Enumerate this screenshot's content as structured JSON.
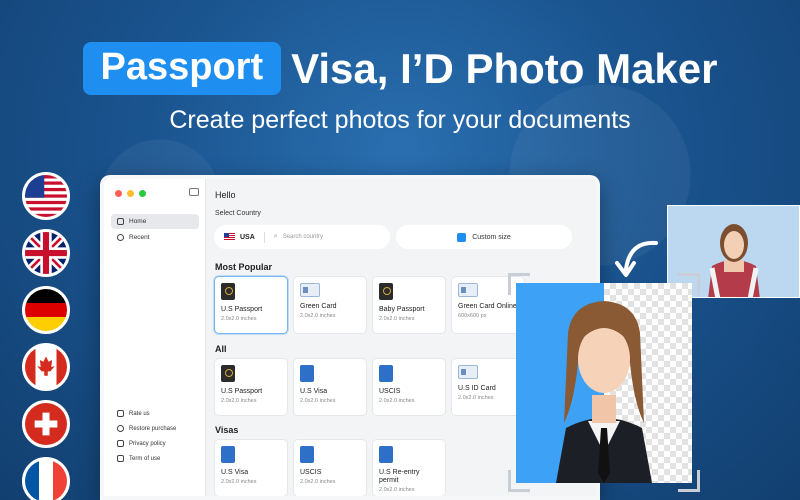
{
  "header": {
    "highlight": "Passport",
    "title_rest": "Visa, I’D Photo Maker",
    "subtitle": "Create perfect photos for your documents"
  },
  "flags": [
    "us-flag-icon",
    "uk-flag-icon",
    "germany-flag-icon",
    "canada-flag-icon",
    "switzerland-flag-icon",
    "france-flag-icon"
  ],
  "colors": {
    "accent": "#1e8ff0",
    "background": "#1a548f"
  },
  "sidebar": {
    "items": [
      {
        "label": "Home",
        "icon": "home-icon",
        "active": true
      },
      {
        "label": "Recent",
        "icon": "clock-icon",
        "active": false
      }
    ],
    "bottom_items": [
      {
        "label": "Rate us",
        "icon": "thumbs-up-icon"
      },
      {
        "label": "Restore purchase",
        "icon": "restore-icon"
      },
      {
        "label": "Privacy policy",
        "icon": "shield-icon"
      },
      {
        "label": "Term of use",
        "icon": "document-icon"
      }
    ]
  },
  "main": {
    "greeting": "Hello",
    "select_country_label": "Select Country",
    "country_code": "USA",
    "search_placeholder": "Search country",
    "custom_size_label": "Custom size",
    "most_popular_title": "Most Popular",
    "most_popular": [
      {
        "name": "U.S Passport",
        "size": "2.0x2.0 inches",
        "selected": true
      },
      {
        "name": "Green Card",
        "size": "2.0x2.0 inches"
      },
      {
        "name": "Baby Passport",
        "size": "2.0x2.0 inches"
      },
      {
        "name": "Green Card Online",
        "size": "600x600 px"
      }
    ],
    "all_title": "All",
    "all": [
      {
        "name": "U.S Passport",
        "size": "2.0x2.0 inches"
      },
      {
        "name": "U.S Visa",
        "size": "2.0x2.0 inches"
      },
      {
        "name": "USCIS",
        "size": "2.0x2.0 inches"
      },
      {
        "name": "U.S ID Card",
        "size": "2.0x2.0 inches"
      }
    ],
    "visas_title": "Visas",
    "visas": [
      {
        "name": "U.S Visa",
        "size": "2.0x2.0 inches"
      },
      {
        "name": "USCIS",
        "size": "2.0x2.0 inches"
      },
      {
        "name": "U.S Re-entry permit",
        "size": "2.0x2.0 inches"
      }
    ]
  }
}
